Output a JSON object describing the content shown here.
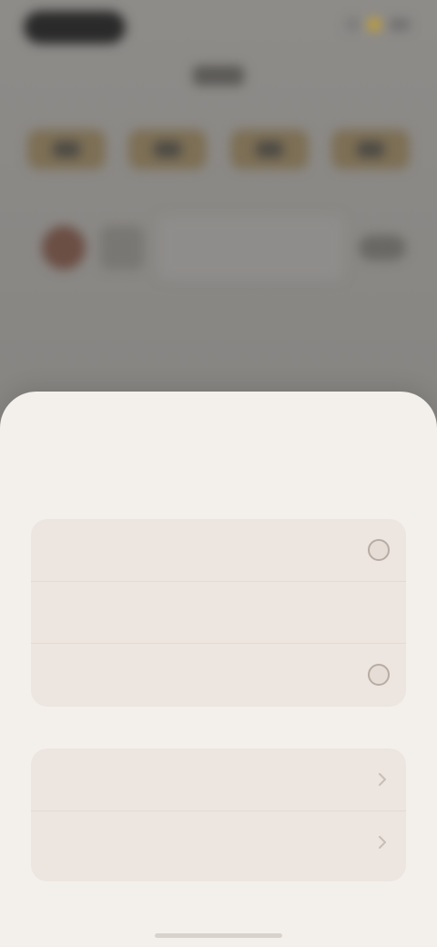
{
  "background_app": {
    "tabs": [
      "tab-1",
      "tab-2",
      "tab-3",
      "tab-4"
    ],
    "accent_color": "#c9a227"
  },
  "sheet": {
    "title": "",
    "subtitle": "",
    "group1": [
      {
        "label": "",
        "value": ""
      },
      {
        "label": "",
        "value": ""
      },
      {
        "label": "",
        "value": ""
      }
    ],
    "group2": [
      {
        "label": "",
        "value": ""
      },
      {
        "label": "",
        "value": ""
      }
    ]
  },
  "colors": {
    "sheet_bg": "#f3f0ec",
    "group_bg": "#ede5df",
    "scrim": "#8a8884"
  }
}
